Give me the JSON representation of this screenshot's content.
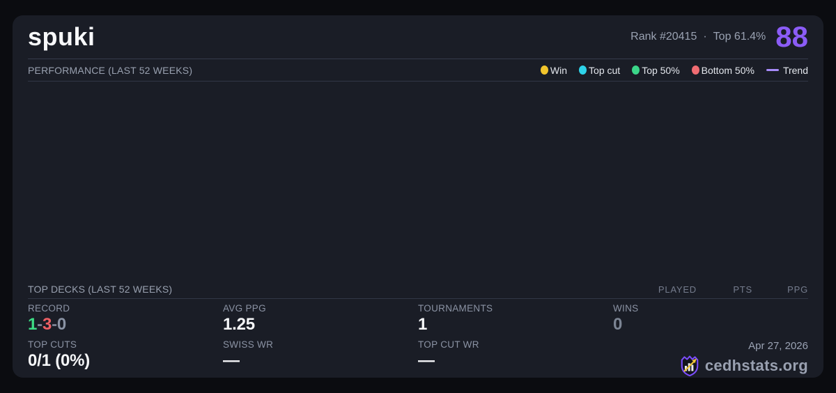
{
  "header": {
    "player_name": "spuki",
    "rank": "Rank #20415",
    "separator": "·",
    "percentile": "Top 61.4%",
    "score": "88"
  },
  "performance": {
    "title": "PERFORMANCE (LAST 52 WEEKS)",
    "legend": [
      {
        "label": "Win",
        "color": "#f2c52c"
      },
      {
        "label": "Top cut",
        "color": "#2ed3e9"
      },
      {
        "label": "Top 50%",
        "color": "#3bd689"
      },
      {
        "label": "Bottom 50%",
        "color": "#f06c72"
      },
      {
        "label": "Trend",
        "color": "#a78bfa"
      }
    ]
  },
  "top_decks": {
    "title": "TOP DECKS (LAST 52 WEEKS)",
    "columns": [
      "PLAYED",
      "PTS",
      "PPG"
    ],
    "rows": []
  },
  "stats": {
    "record": {
      "label": "RECORD",
      "wins": "1",
      "losses": "3",
      "draws": "0",
      "separator": "-"
    },
    "avg_ppg": {
      "label": "AVG PPG",
      "value": "1.25"
    },
    "tournaments": {
      "label": "TOURNAMENTS",
      "value": "1"
    },
    "wins": {
      "label": "WINS",
      "value": "0"
    },
    "top_cuts": {
      "label": "TOP CUTS",
      "value": "0/1 (0%)"
    },
    "swiss_wr": {
      "label": "SWISS WR",
      "value": "—"
    },
    "top_cut_wr": {
      "label": "TOP CUT WR",
      "value": "—"
    }
  },
  "footer": {
    "date": "Apr 27, 2026",
    "brand": "cedhstats.org"
  },
  "colors": {
    "accent_purple": "#8b5cf6",
    "record_win_green": "#3ddc84",
    "record_loss_red": "#ee5f64",
    "card_background": "#1a1d26",
    "page_background": "#0b0c10"
  }
}
